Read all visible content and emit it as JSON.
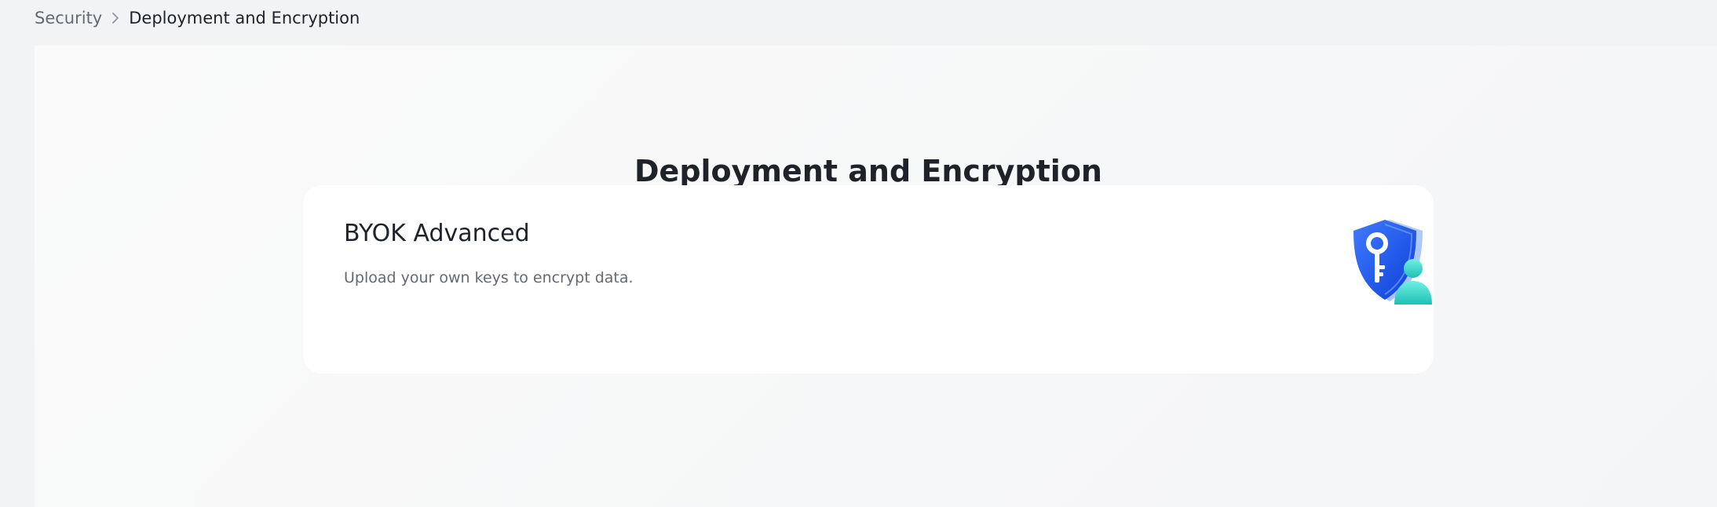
{
  "breadcrumb": {
    "parent": "Security",
    "separator_icon": "chevron-right-icon",
    "current": "Deployment and Encryption"
  },
  "page": {
    "title": "Deployment and Encryption"
  },
  "cards": [
    {
      "title": "BYOK Advanced",
      "description": "Upload your own keys to encrypt data.",
      "illustration": "shield-key-user-icon"
    }
  ],
  "colors": {
    "page_background": "#f2f3f5",
    "card_background": "#ffffff",
    "text_primary": "#1f2329",
    "text_secondary": "#646a73",
    "shield_blue": "#1a5cff",
    "user_teal": "#2fd3c7"
  }
}
